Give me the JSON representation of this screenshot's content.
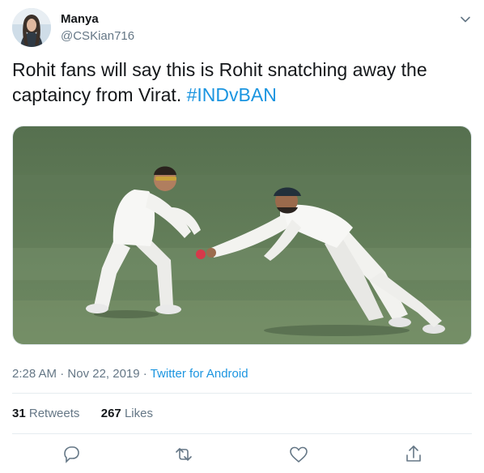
{
  "user": {
    "name": "Manya",
    "handle": "@CSKian716"
  },
  "tweet": {
    "text_part1": "Rohit fans will say this is Rohit snatching away the captaincy from Virat. ",
    "hashtag": "#INDvBAN",
    "time": "2:28 AM",
    "separator1": " · ",
    "date": "Nov 22, 2019",
    "separator2": " · ",
    "source": "Twitter for Android"
  },
  "stats": {
    "retweets_count": "31",
    "retweets_label": "Retweets",
    "likes_count": "267",
    "likes_label": "Likes"
  },
  "icons": {
    "menu": "chevron-down-icon",
    "reply": "reply-icon",
    "retweet": "retweet-icon",
    "like": "heart-icon",
    "share": "share-icon"
  },
  "colors": {
    "link": "#1b95e0",
    "secondary_text": "#657786",
    "primary_text": "#14171a"
  }
}
